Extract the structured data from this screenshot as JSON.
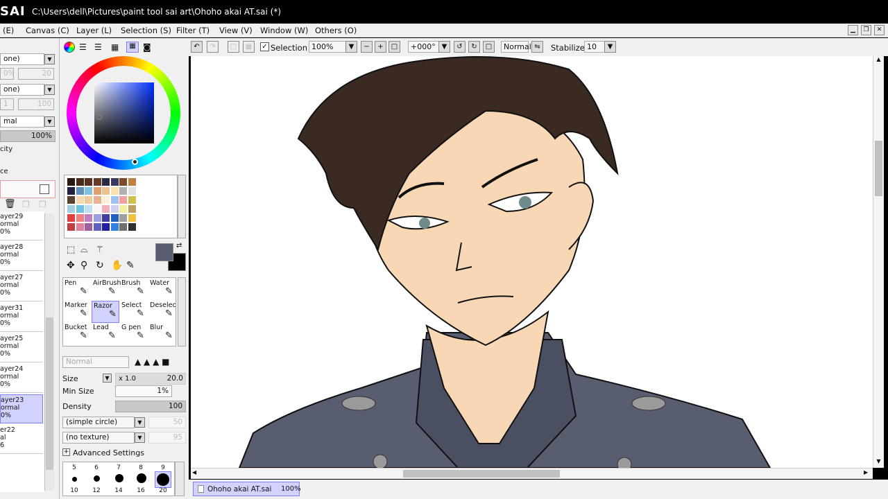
{
  "app": {
    "logo": "SAI",
    "title": "C:\\Users\\dell\\Pictures\\paint tool sai art\\Ohoho akai AT.sai (*)"
  },
  "menu": [
    "(E)",
    "Canvas (C)",
    "Layer (L)",
    "Selection (S)",
    "Filter (T)",
    "View (V)",
    "Window (W)",
    "Others (O)"
  ],
  "toolbar": {
    "selection_label": "Selection",
    "zoom": "100%",
    "angle": "+000°",
    "mode": "Normal",
    "stabilizer_label": "Stabilizer",
    "stabilizer_value": "10"
  },
  "left_panel": {
    "combo1": "one)",
    "combo2": "one)",
    "blend": "mal",
    "opacity": "100%",
    "label_opacity": "city",
    "label_protect": "ce",
    "field1": "0%",
    "field1b": "20",
    "field2": "1",
    "field2b": "100",
    "layers": [
      {
        "name": "ayer29",
        "mode": "ormal",
        "opacity": "0%"
      },
      {
        "name": "ayer28",
        "mode": "ormal",
        "opacity": "0%"
      },
      {
        "name": "ayer27",
        "mode": "ormal",
        "opacity": "0%"
      },
      {
        "name": "ayer31",
        "mode": "ormal",
        "opacity": "0%"
      },
      {
        "name": "ayer25",
        "mode": "ormal",
        "opacity": "0%"
      },
      {
        "name": "ayer24",
        "mode": "ormal",
        "opacity": "0%"
      },
      {
        "name": "ayer23",
        "mode": "ormal",
        "opacity": "0%"
      },
      {
        "name": "er22",
        "mode": "al",
        "opacity": "6"
      }
    ]
  },
  "palette": {
    "colors": [
      "#2a1a14",
      "#4a2a1c",
      "#5a3020",
      "#6a3a28",
      "#2a2a44",
      "#3a3a5a",
      "#7a4a2a",
      "#c08040",
      "#202040",
      "#6090c0",
      "#80c0e0",
      "#e0a070",
      "#f0c090",
      "#f8e0b0",
      "#b0b0b0",
      "#e0e0e0",
      "#5a4030",
      "#f8d8b0",
      "#f0c8a0",
      "#e8b090",
      "#f8f0d8",
      "#a0c0f0",
      "#f0a0a0",
      "#d0c050",
      "#a0d0e0",
      "#70c0e0",
      "#c0e0f0",
      "#f8f8f8",
      "#f0b0c0",
      "#d0d0f0",
      "#f0f0a0",
      "#c0a060",
      "#e04040",
      "#f08080",
      "#c080c0",
      "#a0a0e0",
      "#4040a0",
      "#2060c0",
      "#a0a0a0",
      "#f0c040",
      "#c04040",
      "#e080a0",
      "#a060a0",
      "#6060c0",
      "#2020a0",
      "#3080e0",
      "#707070",
      "#303030"
    ]
  },
  "colors": {
    "primary": "#585d70",
    "secondary": "#000000"
  },
  "tools": [
    {
      "name": "Pen",
      "selected": false
    },
    {
      "name": "AirBrush",
      "selected": false
    },
    {
      "name": "Brush",
      "selected": false
    },
    {
      "name": "Water",
      "selected": false
    },
    {
      "name": "Marker",
      "selected": false
    },
    {
      "name": "Razor",
      "selected": true
    },
    {
      "name": "Select",
      "selected": false
    },
    {
      "name": "Deselect",
      "selected": false
    },
    {
      "name": "Bucket",
      "selected": false
    },
    {
      "name": "Lead",
      "selected": false
    },
    {
      "name": "G pen",
      "selected": false
    },
    {
      "name": "Blur",
      "selected": false
    }
  ],
  "brush": {
    "mode": "Normal",
    "size_label": "Size",
    "size_mult": "x 1.0",
    "size": "20.0",
    "minsize_label": "Min Size",
    "minsize": "1%",
    "density_label": "Density",
    "density": "100",
    "shape": "(simple circle)",
    "shape_value": "50",
    "texture": "(no texture)",
    "texture_value": "95",
    "advanced": "Advanced Settings",
    "sizes_top": [
      "5",
      "6",
      "7",
      "8",
      "9"
    ],
    "sizes_bottom": [
      "10",
      "12",
      "14",
      "16",
      "20"
    ]
  },
  "status": {
    "file": "Ohoho akai AT.sai",
    "zoom": "100%"
  }
}
